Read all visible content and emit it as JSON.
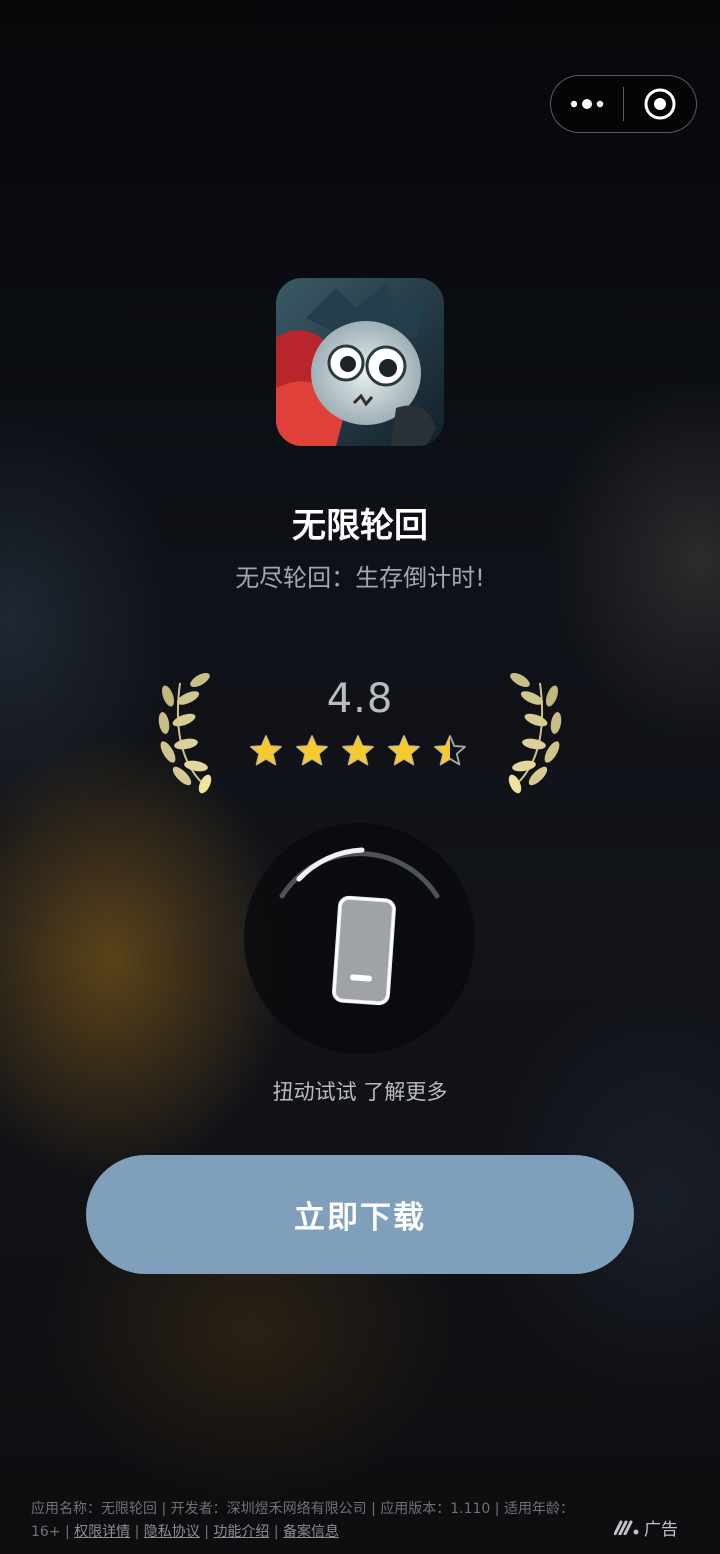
{
  "app": {
    "name": "无限轮回",
    "slogan": "无尽轮回：生存倒计时!"
  },
  "rating": {
    "value": "4.8",
    "stars": 4.5,
    "max_stars": 5
  },
  "shake": {
    "hint": "扭动试试 了解更多"
  },
  "download": {
    "label": "立即下载"
  },
  "footer": {
    "app_name_label": "应用名称：",
    "app_name": "无限轮回",
    "developer_label": "开发者：",
    "developer": "深圳煜禾网络有限公司",
    "version_label": "应用版本：",
    "version": "1.110",
    "age_label": "适用年龄：",
    "age": "16+",
    "links": [
      "权限详情",
      "隐私协议",
      "功能介绍",
      "备案信息"
    ],
    "separator": "|"
  },
  "ad_badge": {
    "label": "广告"
  },
  "colors": {
    "button": "#7f9fba",
    "star": "#f7c92d",
    "laurel": "#d6c98e"
  }
}
